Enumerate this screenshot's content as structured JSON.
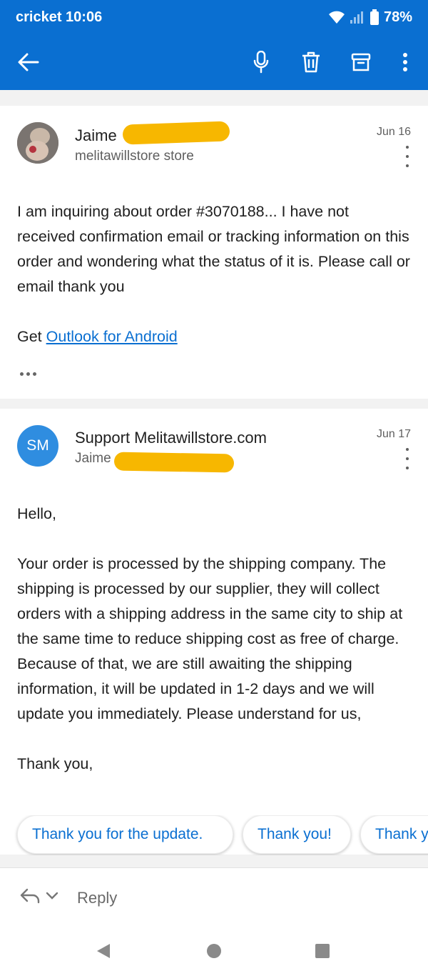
{
  "status_bar": {
    "carrier_time": "cricket  10:06",
    "battery": "78%"
  },
  "toolbar": {
    "back_icon": "arrow-left-icon",
    "mic_icon": "microphone-icon",
    "delete_icon": "trash-icon",
    "archive_icon": "archive-icon",
    "more_icon": "more-vertical-icon"
  },
  "messages": [
    {
      "sender": "Jaime",
      "recipient": "melitawillstore store",
      "date": "Jun 16",
      "body": [
        "I am inquiring about order #3070188... I have not received confirmation email or tracking information on this order and wondering what the status of it is. Please call or email thank you"
      ],
      "footer_prefix": "Get ",
      "footer_link": "Outlook for Android"
    },
    {
      "avatar_initials": "SM",
      "sender": "Support Melitawillstore.com",
      "recipient": "Jaime",
      "date": "Jun 17",
      "greeting": "Hello,",
      "body": [
        "Your order is processed by the shipping company. The shipping is processed by our supplier, they will collect orders with a shipping address in the same city to ship at the same time to reduce shipping cost as free of charge. Because of that, we are still awaiting the shipping information, it will be updated in 1-2 days and we will update you immediately. Please understand for us,"
      ],
      "closing": "Thank you,"
    }
  ],
  "quick_replies": [
    "Thank you for the update.",
    "Thank you!",
    "Thank you"
  ],
  "reply_bar": {
    "label": "Reply"
  },
  "colors": {
    "accent": "#0a6fd1",
    "avatar_sm": "#2f8de0",
    "redaction": "#f7b700"
  }
}
